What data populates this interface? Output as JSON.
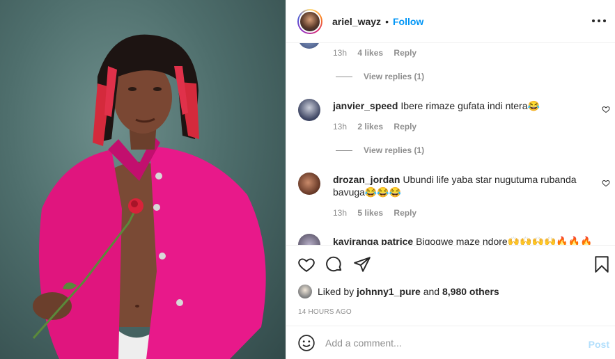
{
  "header": {
    "username": "ariel_wayz",
    "separator": "•",
    "follow_label": "Follow"
  },
  "comments": [
    {
      "username": "",
      "text": "",
      "time": "13h",
      "likes": "4 likes",
      "reply_label": "Reply",
      "view_replies": "View replies (1)"
    },
    {
      "username": "janvier_speed",
      "text": "Ibere rimaze gufata indi ntera😂",
      "time": "13h",
      "likes": "2 likes",
      "reply_label": "Reply",
      "view_replies": "View replies (1)"
    },
    {
      "username": "drozan_jordan",
      "text": "Ubundi life yaba star nugutuma rubanda bavuga😂😂😂",
      "time": "13h",
      "likes": "5 likes",
      "reply_label": "Reply"
    },
    {
      "username": "kaviranga patrice",
      "text": "Bigogwe maze ndore🙌🙌🙌🙌🔥🔥🔥"
    }
  ],
  "likes_row": {
    "liked_by_prefix": "Liked by",
    "liked_by_user": "johnny1_pure",
    "and_text": "and",
    "others": "8,980 others"
  },
  "timestamp": "14 HOURS AGO",
  "add_comment": {
    "placeholder": "Add a comment...",
    "post_label": "Post"
  },
  "icons": {
    "like": "heart-icon",
    "comment": "comment-icon",
    "share": "share-icon",
    "save": "bookmark-icon",
    "emoji": "emoji-icon",
    "more": "more-options-icon"
  },
  "colors": {
    "accent": "#0095f6",
    "post_disabled": "#b2dffc",
    "muted": "#8e8e8e",
    "text": "#262626"
  }
}
